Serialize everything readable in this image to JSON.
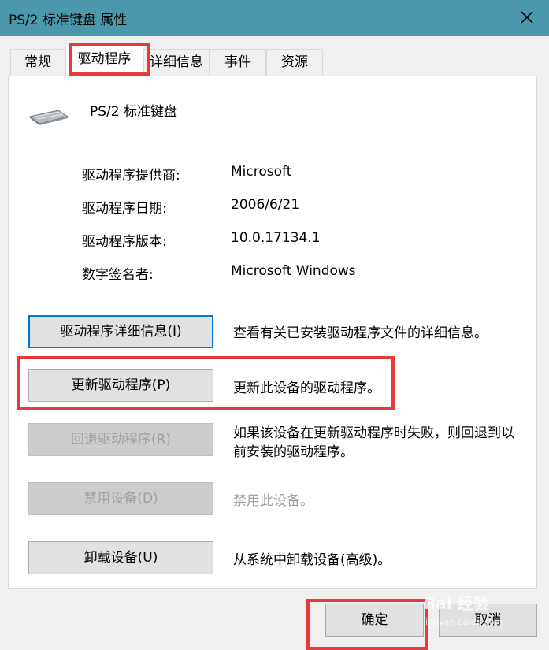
{
  "window": {
    "title": "PS/2 标准键盘 属性",
    "close_icon": "close-icon"
  },
  "tabs": [
    {
      "label": "常规"
    },
    {
      "label": "驱动程序",
      "active": true
    },
    {
      "label": "详细信息"
    },
    {
      "label": "事件"
    },
    {
      "label": "资源"
    }
  ],
  "device": {
    "icon": "keyboard-icon",
    "name": "PS/2 标准键盘"
  },
  "info": {
    "provider_label": "驱动程序提供商:",
    "provider_value": "Microsoft",
    "date_label": "驱动程序日期:",
    "date_value": "2006/6/21",
    "version_label": "驱动程序版本:",
    "version_value": "10.0.17134.1",
    "signer_label": "数字签名者:",
    "signer_value": "Microsoft Windows"
  },
  "actions": {
    "details_button": "驱动程序详细信息(I)",
    "details_desc": "查看有关已安装驱动程序文件的详细信息。",
    "update_button": "更新驱动程序(P)",
    "update_desc": "更新此设备的驱动程序。",
    "rollback_button": "回退驱动程序(R)",
    "rollback_desc": "如果该设备在更新驱动程序时失败，则回退到以前安装的驱动程序。",
    "disable_button": "禁用设备(D)",
    "disable_desc": "禁用此设备。",
    "uninstall_button": "卸载设备(U)",
    "uninstall_desc": "从系统中卸载设备(高级)。"
  },
  "footer": {
    "ok_button": "确定",
    "cancel_button": "取消"
  },
  "watermark": {
    "brand": "Bai 经验",
    "url": "jingyan.baidu.com"
  },
  "colors": {
    "titlebar": "#4b98ac",
    "highlight": "#e8393c",
    "focus": "#0078d7"
  }
}
